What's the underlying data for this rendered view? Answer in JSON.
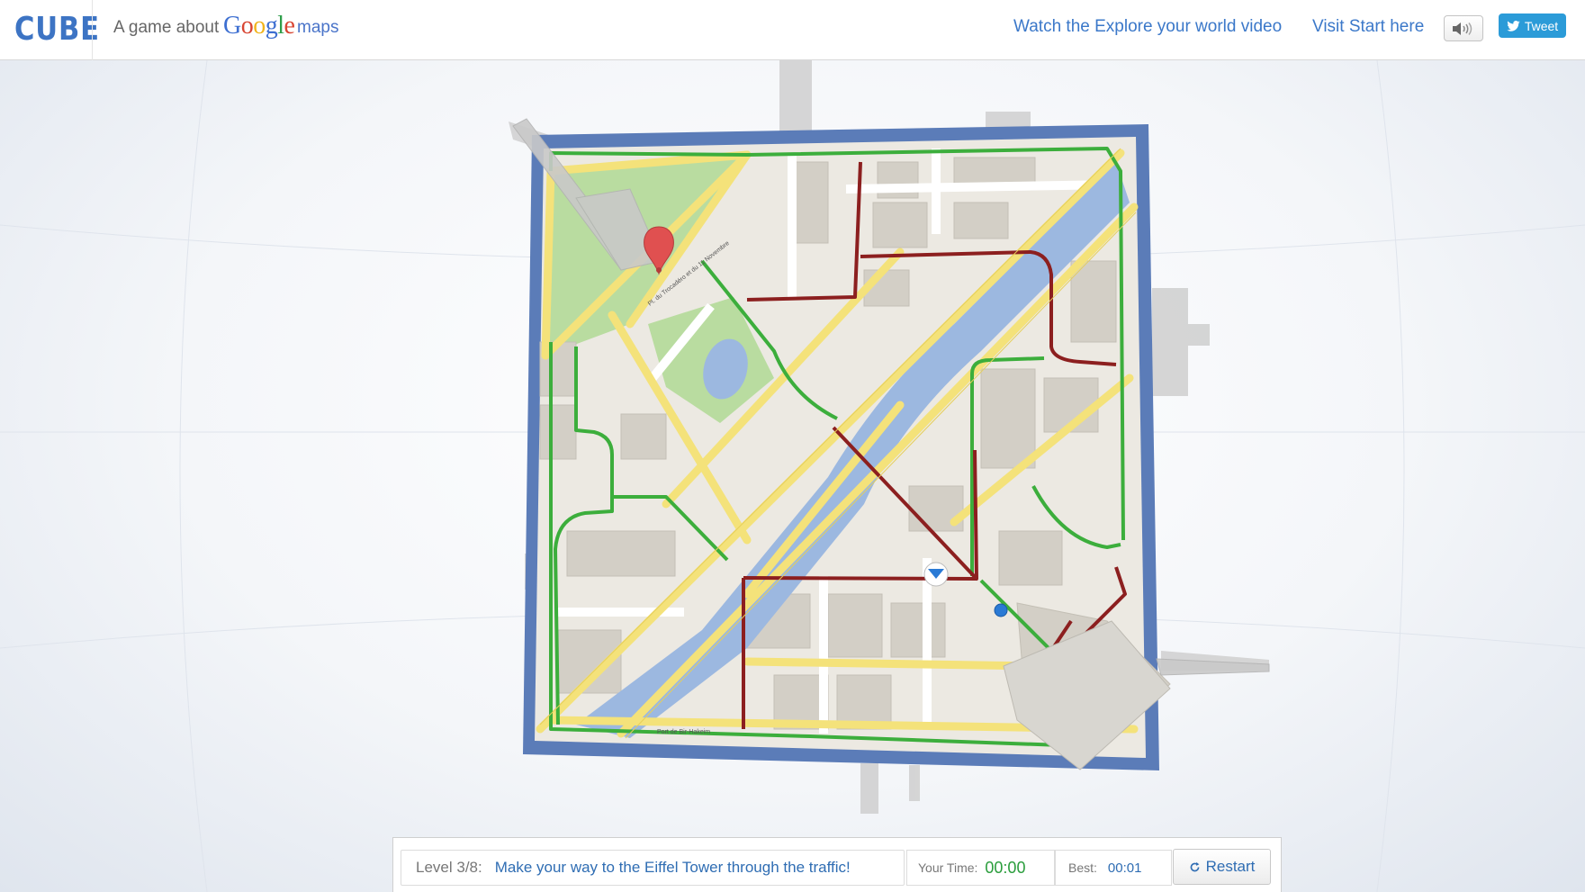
{
  "header": {
    "logo": "CUBE",
    "tagline": "A game about",
    "google_letters": [
      {
        "ch": "G",
        "color": "#3d6fd1"
      },
      {
        "ch": "o",
        "color": "#d84532"
      },
      {
        "ch": "o",
        "color": "#f0b41c"
      },
      {
        "ch": "g",
        "color": "#3d6fd1"
      },
      {
        "ch": "l",
        "color": "#2e9e4a"
      },
      {
        "ch": "e",
        "color": "#d84532"
      }
    ],
    "maps_word": "maps",
    "link_video": "Watch the Explore your world video",
    "link_start": "Visit Start here",
    "sound_icon": "speaker-icon",
    "tweet_label": "Tweet"
  },
  "map": {
    "street_top": "Pl. du Trocadéro et du 11 Novembre",
    "street_bottom": "Port de Bir-Hakeim",
    "colors": {
      "frame": "#5b7cb8",
      "river": "#9cb8e0",
      "park": "#b9dca0",
      "road_yellow": "#f4e27a",
      "traffic_green": "#3cae3c",
      "traffic_red": "#8c1f1f",
      "marker": "#e05050",
      "player": "#2a7ad5"
    }
  },
  "status": {
    "level_label": "Level 3/8:",
    "level_message": "Make your way to the Eiffel Tower through the traffic!",
    "your_time_label": "Your Time:",
    "your_time_value": "00:00",
    "best_label": "Best:",
    "best_value": "00:01",
    "restart_label": "Restart",
    "restart_icon": "refresh-icon"
  }
}
